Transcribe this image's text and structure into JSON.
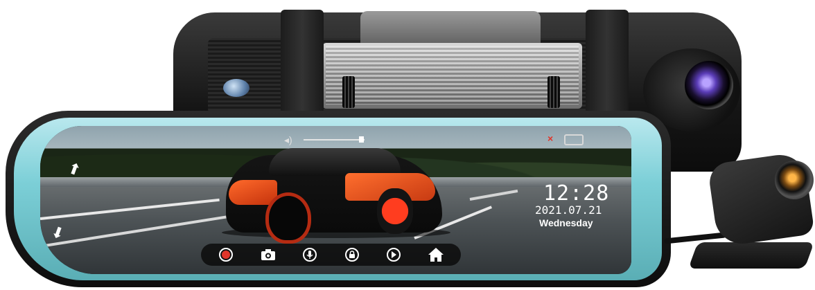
{
  "osd": {
    "clock": "12:28",
    "date": "2021.07.21",
    "weekday": "Wednesday",
    "volume_level": 0.95,
    "sd_status": "no-card"
  },
  "toolbar": {
    "buttons": [
      {
        "name": "record-button",
        "icon": "record-icon"
      },
      {
        "name": "camera-button",
        "icon": "camera-icon"
      },
      {
        "name": "microphone-button",
        "icon": "microphone-icon"
      },
      {
        "name": "lock-button",
        "icon": "lock-icon"
      },
      {
        "name": "playback-button",
        "icon": "play-icon"
      },
      {
        "name": "home-button",
        "icon": "home-icon"
      }
    ]
  },
  "colors": {
    "record_red": "#e0352a",
    "mirror_glass": "#7ccfd7",
    "car_orange": "#ff6a2b"
  }
}
